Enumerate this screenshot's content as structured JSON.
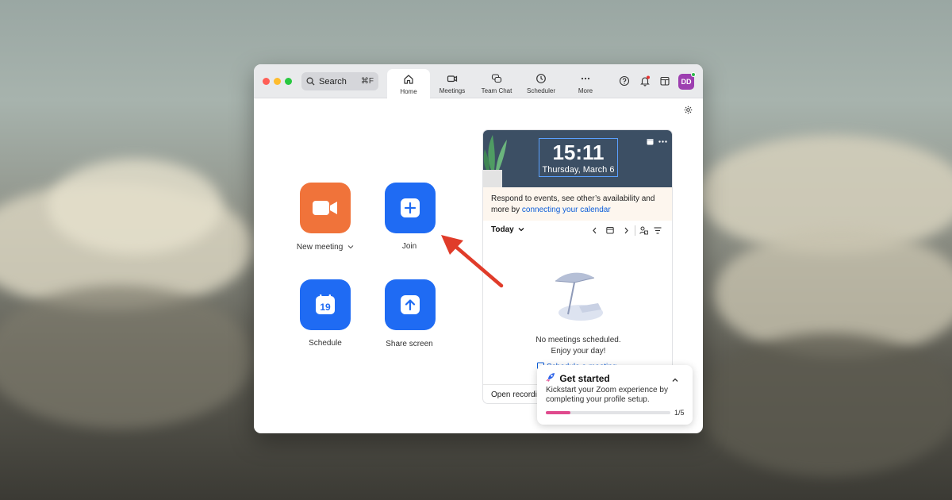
{
  "titlebar": {
    "search": {
      "icon": "search-icon",
      "label": "Search",
      "shortcut": "⌘F"
    },
    "tabs": [
      {
        "label": "Home",
        "icon": "home-icon",
        "active": true
      },
      {
        "label": "Meetings",
        "icon": "video-icon",
        "active": false
      },
      {
        "label": "Team Chat",
        "icon": "chat-icon",
        "active": false
      },
      {
        "label": "Scheduler",
        "icon": "clock-icon",
        "active": false
      },
      {
        "label": "More",
        "icon": "more-icon",
        "active": false
      }
    ],
    "right_icons": [
      "help-icon",
      "bell-icon",
      "calendar-icon"
    ],
    "avatar": {
      "initials": "DD",
      "color": "#9d3fb0",
      "status": "online"
    }
  },
  "actions": {
    "new_meeting": {
      "label": "New meeting",
      "color": "#f0733a",
      "icon": "video-camera-icon"
    },
    "join": {
      "label": "Join",
      "color": "#1f6bf3",
      "icon": "plus-icon"
    },
    "schedule": {
      "label": "Schedule",
      "color": "#1f6bf3",
      "icon": "calendar-19-icon",
      "day": "19"
    },
    "share_screen": {
      "label": "Share screen",
      "color": "#1f6bf3",
      "icon": "upload-arrow-icon"
    }
  },
  "calendar_panel": {
    "time": "15:11",
    "date": "Thursday, March 6",
    "notice_text": "Respond to events, see other’s availability and more by ",
    "notice_link": "connecting your calendar",
    "today_label": "Today",
    "empty_line1": "No meetings scheduled.",
    "empty_line2": "Enjoy your day!",
    "schedule_link": "Schedule a meeting",
    "footer_text": "Open recordings"
  },
  "get_started": {
    "title": "Get started",
    "text": "Kickstart your Zoom experience by completing your profile setup.",
    "progress_current": 1,
    "progress_total": 5,
    "progress_label": "1/5",
    "accent": "#e04a8d"
  },
  "annotation": {
    "arrow_color": "#e03c2a"
  }
}
